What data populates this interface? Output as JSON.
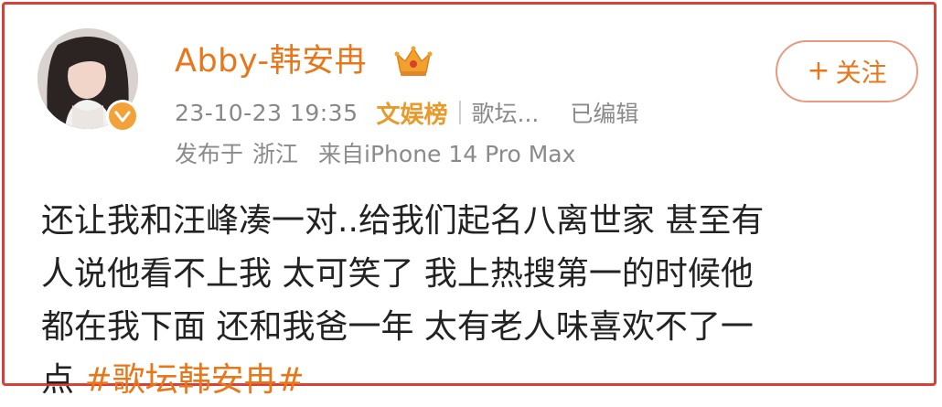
{
  "post": {
    "author": {
      "name": "Abby-韩安冉",
      "avatar_icon": "user-avatar",
      "verified_icon": "verified-badge-icon",
      "crown_icon": "crown-icon"
    },
    "follow_button": {
      "plus": "+",
      "label": "关注"
    },
    "meta": {
      "time": "23-10-23 19:35",
      "rank_label": "文娱榜",
      "section_label": "歌坛...",
      "edited_label": "已编辑"
    },
    "source": {
      "prefix": "发布于",
      "location": "浙江",
      "device": "来自iPhone 14 Pro Max"
    },
    "content": {
      "line1": "还让我和汪峰凑一对..给我们起名八离世家 甚至有",
      "line2": "人说他看不上我 太可笑了 我上热搜第一的时候他",
      "line3": "都在我下面 还和我爸一年 太有老人味喜欢不了一",
      "line4_prefix": "点 ",
      "line4_topic": "#歌坛韩安冉#"
    },
    "colors": {
      "accent": "#e8761b",
      "frame_border": "#d9403a",
      "muted_text": "#888888",
      "body_text": "#222222"
    }
  }
}
